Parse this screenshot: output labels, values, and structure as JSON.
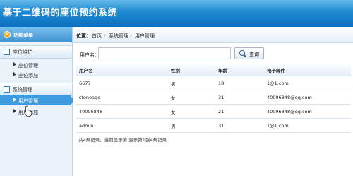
{
  "app": {
    "title": "基于二维码的座位预约系统"
  },
  "sidebar": {
    "header": "功能菜单",
    "groups": [
      {
        "label": "座位维护",
        "items": [
          {
            "label": "座位管理"
          },
          {
            "label": "座位添加"
          }
        ]
      },
      {
        "label": "系统管理",
        "items": [
          {
            "label": "用户管理"
          },
          {
            "label": "用户添加"
          }
        ]
      }
    ]
  },
  "breadcrumb": {
    "prefix": "位置：",
    "home": "首页",
    "sep": "›",
    "section": "系统管理",
    "page": "用户管理"
  },
  "search": {
    "label": "用户名：",
    "value": "",
    "button": "查询"
  },
  "table": {
    "headers": [
      "用户名",
      "性别",
      "年龄",
      "电子邮件"
    ],
    "rows": [
      [
        "6677",
        "男",
        "18",
        "1@1.com"
      ],
      [
        "stoneage",
        "女",
        "31",
        "40096848@qq.com"
      ],
      [
        "40096848",
        "女",
        "21",
        "40096848@qq.com"
      ],
      [
        "admin",
        "男",
        "31",
        "1@1.com"
      ]
    ]
  },
  "footer": {
    "summary": "共4条记录，当前显示第  显示第1到4条记录"
  },
  "colors": {
    "header": "#1785d1",
    "active": "#3e9cde",
    "accent": "#f2a51f"
  }
}
